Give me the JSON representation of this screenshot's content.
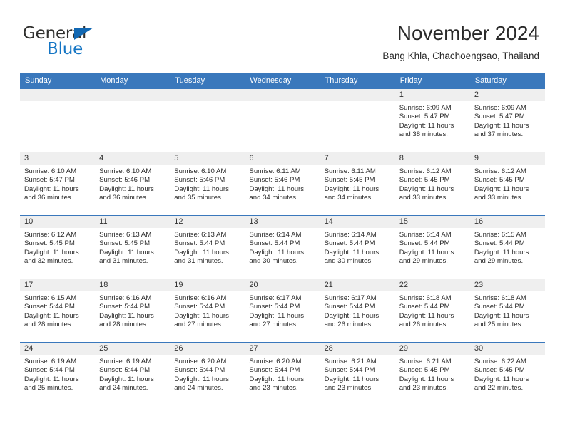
{
  "brand": {
    "name_part1": "General",
    "name_part2": "Blue",
    "triangle_icon": "blue-triangle-icon",
    "color_dark": "#31312f",
    "color_blue": "#1475c4"
  },
  "header": {
    "month_title": "November 2024",
    "location": "Bang Khla, Chachoengsao, Thailand",
    "header_bg": "#3a78bc"
  },
  "weekdays": [
    "Sunday",
    "Monday",
    "Tuesday",
    "Wednesday",
    "Thursday",
    "Friday",
    "Saturday"
  ],
  "weeks": [
    [
      {
        "day": "",
        "lines": []
      },
      {
        "day": "",
        "lines": []
      },
      {
        "day": "",
        "lines": []
      },
      {
        "day": "",
        "lines": []
      },
      {
        "day": "",
        "lines": []
      },
      {
        "day": "1",
        "lines": [
          "Sunrise: 6:09 AM",
          "Sunset: 5:47 PM",
          "Daylight: 11 hours",
          "and 38 minutes."
        ]
      },
      {
        "day": "2",
        "lines": [
          "Sunrise: 6:09 AM",
          "Sunset: 5:47 PM",
          "Daylight: 11 hours",
          "and 37 minutes."
        ]
      }
    ],
    [
      {
        "day": "3",
        "lines": [
          "Sunrise: 6:10 AM",
          "Sunset: 5:47 PM",
          "Daylight: 11 hours",
          "and 36 minutes."
        ]
      },
      {
        "day": "4",
        "lines": [
          "Sunrise: 6:10 AM",
          "Sunset: 5:46 PM",
          "Daylight: 11 hours",
          "and 36 minutes."
        ]
      },
      {
        "day": "5",
        "lines": [
          "Sunrise: 6:10 AM",
          "Sunset: 5:46 PM",
          "Daylight: 11 hours",
          "and 35 minutes."
        ]
      },
      {
        "day": "6",
        "lines": [
          "Sunrise: 6:11 AM",
          "Sunset: 5:46 PM",
          "Daylight: 11 hours",
          "and 34 minutes."
        ]
      },
      {
        "day": "7",
        "lines": [
          "Sunrise: 6:11 AM",
          "Sunset: 5:45 PM",
          "Daylight: 11 hours",
          "and 34 minutes."
        ]
      },
      {
        "day": "8",
        "lines": [
          "Sunrise: 6:12 AM",
          "Sunset: 5:45 PM",
          "Daylight: 11 hours",
          "and 33 minutes."
        ]
      },
      {
        "day": "9",
        "lines": [
          "Sunrise: 6:12 AM",
          "Sunset: 5:45 PM",
          "Daylight: 11 hours",
          "and 33 minutes."
        ]
      }
    ],
    [
      {
        "day": "10",
        "lines": [
          "Sunrise: 6:12 AM",
          "Sunset: 5:45 PM",
          "Daylight: 11 hours",
          "and 32 minutes."
        ]
      },
      {
        "day": "11",
        "lines": [
          "Sunrise: 6:13 AM",
          "Sunset: 5:45 PM",
          "Daylight: 11 hours",
          "and 31 minutes."
        ]
      },
      {
        "day": "12",
        "lines": [
          "Sunrise: 6:13 AM",
          "Sunset: 5:44 PM",
          "Daylight: 11 hours",
          "and 31 minutes."
        ]
      },
      {
        "day": "13",
        "lines": [
          "Sunrise: 6:14 AM",
          "Sunset: 5:44 PM",
          "Daylight: 11 hours",
          "and 30 minutes."
        ]
      },
      {
        "day": "14",
        "lines": [
          "Sunrise: 6:14 AM",
          "Sunset: 5:44 PM",
          "Daylight: 11 hours",
          "and 30 minutes."
        ]
      },
      {
        "day": "15",
        "lines": [
          "Sunrise: 6:14 AM",
          "Sunset: 5:44 PM",
          "Daylight: 11 hours",
          "and 29 minutes."
        ]
      },
      {
        "day": "16",
        "lines": [
          "Sunrise: 6:15 AM",
          "Sunset: 5:44 PM",
          "Daylight: 11 hours",
          "and 29 minutes."
        ]
      }
    ],
    [
      {
        "day": "17",
        "lines": [
          "Sunrise: 6:15 AM",
          "Sunset: 5:44 PM",
          "Daylight: 11 hours",
          "and 28 minutes."
        ]
      },
      {
        "day": "18",
        "lines": [
          "Sunrise: 6:16 AM",
          "Sunset: 5:44 PM",
          "Daylight: 11 hours",
          "and 28 minutes."
        ]
      },
      {
        "day": "19",
        "lines": [
          "Sunrise: 6:16 AM",
          "Sunset: 5:44 PM",
          "Daylight: 11 hours",
          "and 27 minutes."
        ]
      },
      {
        "day": "20",
        "lines": [
          "Sunrise: 6:17 AM",
          "Sunset: 5:44 PM",
          "Daylight: 11 hours",
          "and 27 minutes."
        ]
      },
      {
        "day": "21",
        "lines": [
          "Sunrise: 6:17 AM",
          "Sunset: 5:44 PM",
          "Daylight: 11 hours",
          "and 26 minutes."
        ]
      },
      {
        "day": "22",
        "lines": [
          "Sunrise: 6:18 AM",
          "Sunset: 5:44 PM",
          "Daylight: 11 hours",
          "and 26 minutes."
        ]
      },
      {
        "day": "23",
        "lines": [
          "Sunrise: 6:18 AM",
          "Sunset: 5:44 PM",
          "Daylight: 11 hours",
          "and 25 minutes."
        ]
      }
    ],
    [
      {
        "day": "24",
        "lines": [
          "Sunrise: 6:19 AM",
          "Sunset: 5:44 PM",
          "Daylight: 11 hours",
          "and 25 minutes."
        ]
      },
      {
        "day": "25",
        "lines": [
          "Sunrise: 6:19 AM",
          "Sunset: 5:44 PM",
          "Daylight: 11 hours",
          "and 24 minutes."
        ]
      },
      {
        "day": "26",
        "lines": [
          "Sunrise: 6:20 AM",
          "Sunset: 5:44 PM",
          "Daylight: 11 hours",
          "and 24 minutes."
        ]
      },
      {
        "day": "27",
        "lines": [
          "Sunrise: 6:20 AM",
          "Sunset: 5:44 PM",
          "Daylight: 11 hours",
          "and 23 minutes."
        ]
      },
      {
        "day": "28",
        "lines": [
          "Sunrise: 6:21 AM",
          "Sunset: 5:44 PM",
          "Daylight: 11 hours",
          "and 23 minutes."
        ]
      },
      {
        "day": "29",
        "lines": [
          "Sunrise: 6:21 AM",
          "Sunset: 5:45 PM",
          "Daylight: 11 hours",
          "and 23 minutes."
        ]
      },
      {
        "day": "30",
        "lines": [
          "Sunrise: 6:22 AM",
          "Sunset: 5:45 PM",
          "Daylight: 11 hours",
          "and 22 minutes."
        ]
      }
    ]
  ]
}
